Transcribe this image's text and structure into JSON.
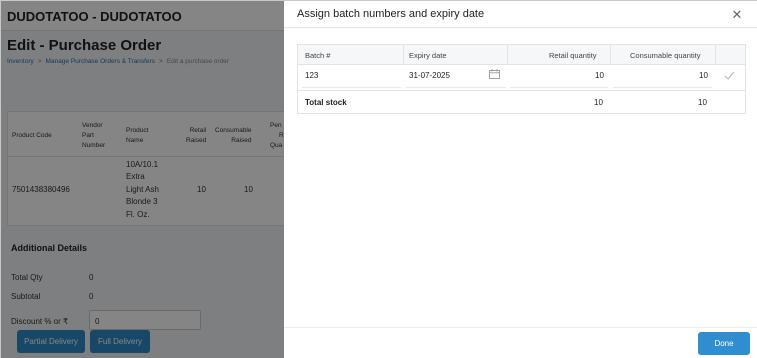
{
  "background": {
    "app_title": "DUDOTATOO - DUDOTATOO",
    "page_title": "Edit - Purchase Order",
    "breadcrumbs": [
      "Inventory",
      "Manage Purchase Orders & Transfers",
      "Edit a purchase order"
    ],
    "table_headers": {
      "product_code": "Product Code",
      "vendor_part_line1": "Vendor",
      "vendor_part_line2": "Part",
      "vendor_part_line3": "Number",
      "product_name_line1": "Product",
      "product_name_line2": "Name",
      "retail_raised_line1": "Retail",
      "retail_raised_line2": "Raised",
      "consumable_raised_line1": "Consumable",
      "consumable_raised_line2": "Raised",
      "partial_line1": "Pen",
      "partial_line2": "R",
      "partial_line3": "Qua"
    },
    "row": {
      "product_code": "7501438380496",
      "product_name_line1": "10A/10.1",
      "product_name_line2": "Extra",
      "product_name_line3": "Light Ash",
      "product_name_line4": "Blonde 3",
      "product_name_line5": "Fl. Oz.",
      "retail_raised": "10",
      "consumable_raised": "10"
    },
    "additional_details_title": "Additional Details",
    "total_qty_label": "Total Qty",
    "total_qty_value": "0",
    "subtotal_label": "Subtotal",
    "subtotal_value": "0",
    "discount_label": "Discount % or ₹",
    "discount_value": "0",
    "partial_delivery_label": "Partial Delivery",
    "full_delivery_label": "Full Delivery"
  },
  "drawer": {
    "title": "Assign batch numbers and expiry date",
    "close_icon": "close-icon",
    "columns": {
      "batch": "Batch #",
      "expiry": "Expiry date",
      "retail": "Retail quantity",
      "consumable": "Consumable quantity"
    },
    "row": {
      "batch": "123",
      "expiry": "31-07-2025",
      "retail": "10",
      "consumable": "10"
    },
    "total": {
      "label": "Total stock",
      "retail": "10",
      "consumable": "10"
    },
    "done_label": "Done"
  }
}
